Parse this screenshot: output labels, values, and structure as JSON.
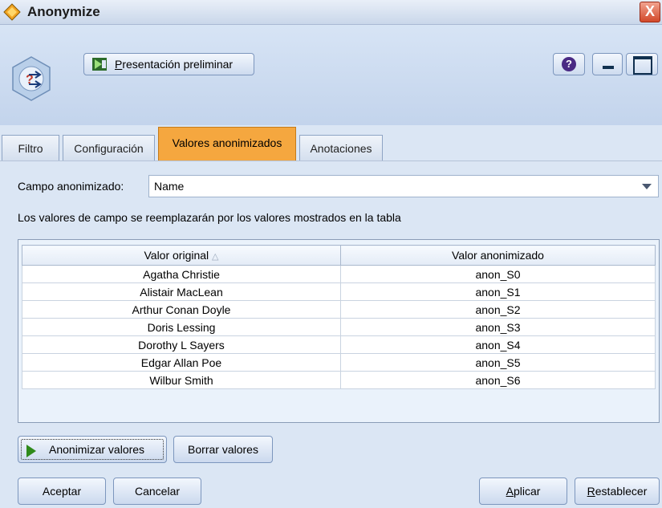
{
  "window": {
    "title": "Anonymize",
    "close_label": "X"
  },
  "toolbar": {
    "preview_label_first": "P",
    "preview_label_rest": "resentación preliminar",
    "help_label": "?"
  },
  "tabs": [
    {
      "label": "Filtro",
      "active": false
    },
    {
      "label": "Configuración",
      "active": false
    },
    {
      "label": "Valores anonimizados",
      "active": true
    },
    {
      "label": "Anotaciones",
      "active": false
    }
  ],
  "field": {
    "label": "Campo anonimizado:",
    "selected": "Name"
  },
  "info_text": "Los valores de campo se reemplazarán por los valores mostrados en la tabla",
  "table": {
    "columns": [
      "Valor original",
      "Valor anonimizado"
    ],
    "rows": [
      [
        "Agatha Christie",
        "anon_S0"
      ],
      [
        "Alistair MacLean",
        "anon_S1"
      ],
      [
        "Arthur Conan Doyle",
        "anon_S2"
      ],
      [
        "Doris Lessing",
        "anon_S3"
      ],
      [
        "Dorothy L Sayers",
        "anon_S4"
      ],
      [
        "Edgar Allan Poe",
        "anon_S5"
      ],
      [
        "Wilbur Smith",
        "anon_S6"
      ]
    ]
  },
  "buttons": {
    "anonymize": "Anonimizar valores",
    "clear": "Borrar valores",
    "ok": "Aceptar",
    "cancel": "Cancelar",
    "apply_first": "A",
    "apply_rest": "plicar",
    "reset_first": "R",
    "reset_rest": "establecer"
  },
  "colors": {
    "active_tab": "#f5a73f",
    "close_button": "#d2482a",
    "play_icon": "#2f8a1a"
  }
}
